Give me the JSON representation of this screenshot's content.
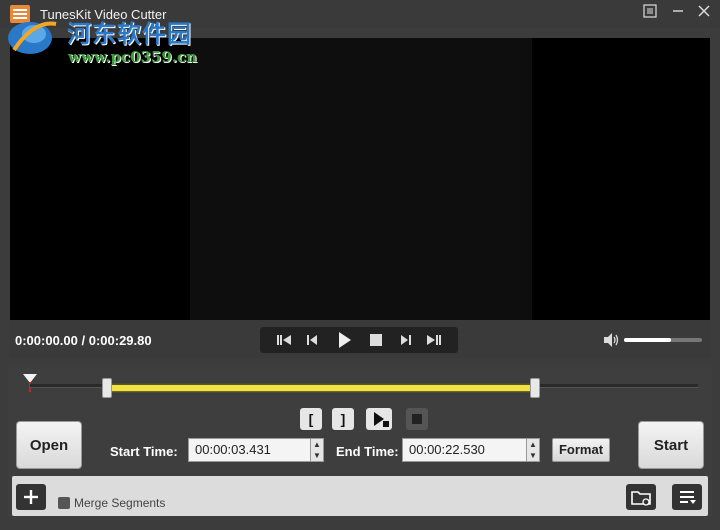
{
  "window": {
    "title": "TunesKit Video Cutter",
    "menu_icon": "menu-icon",
    "minimize_icon": "minimize-icon",
    "close_icon": "close-icon"
  },
  "watermark": {
    "site_name": "河东软件园",
    "url": "www.pc0359.cn"
  },
  "player": {
    "timecode": "0:00:00.00 / 0:00:29.80",
    "volume_level": 0.6
  },
  "cutter": {
    "open_label": "Open",
    "start_time_label": "Start Time:",
    "start_time_value": "00:00:03.431",
    "end_time_label": "End Time:",
    "end_time_value": "00:00:22.530",
    "format_label": "Format",
    "start_label": "Start",
    "mark_in_label": "[",
    "mark_out_label": "]",
    "selection_start_fraction": 0.115,
    "selection_end_fraction": 0.756
  },
  "bottom": {
    "merge_label": "Merge Segments",
    "merged": false
  },
  "colors": {
    "selection": "#f0e242",
    "background": "#3c3c3c",
    "video": "#000000"
  }
}
